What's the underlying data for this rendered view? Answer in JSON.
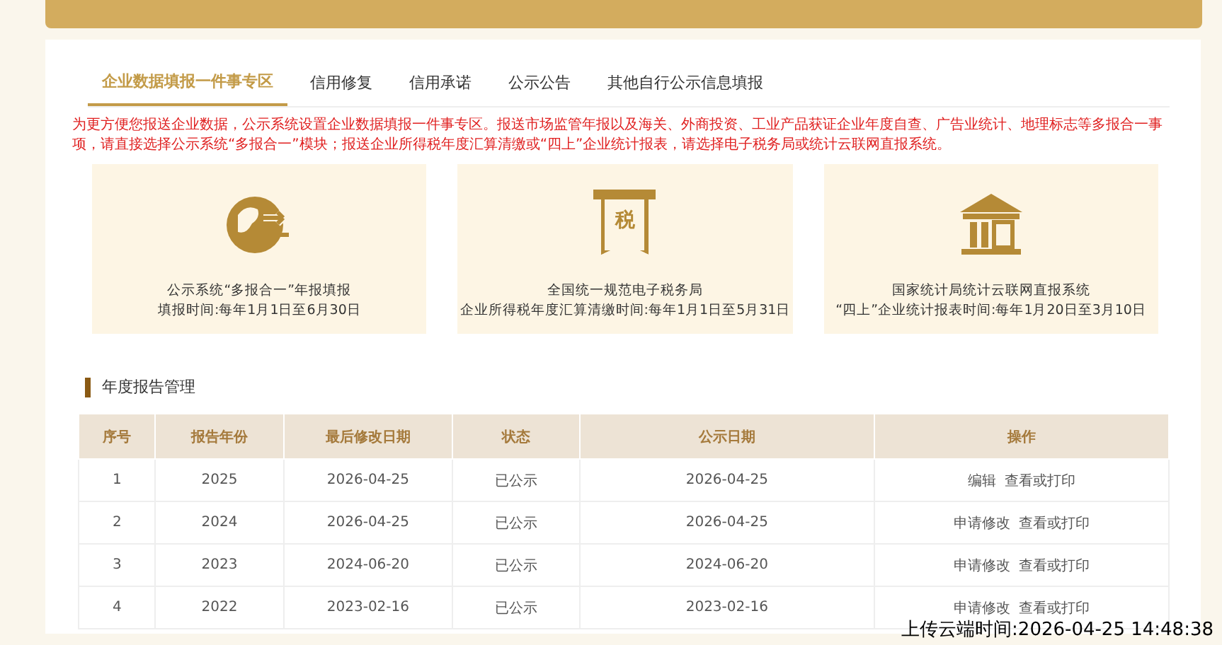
{
  "tabs": [
    {
      "label": "企业数据填报一件事专区",
      "selected": true
    },
    {
      "label": "信用修复",
      "selected": false
    },
    {
      "label": "信用承诺",
      "selected": false
    },
    {
      "label": "公示公告",
      "selected": false
    },
    {
      "label": "其他自行公示信息填报",
      "selected": false
    }
  ],
  "notice": "为更方便您报送企业数据，公示系统设置企业数据填报一件事专区。报送市场监管年报以及海关、外商投资、工业产品获证企业年度自查、广告业统计、地理标志等多报合一事项，请直接选择公示系统“多报合一”模块；报送企业所得税年度汇算清缴或“四上”企业统计报表，请选择电子税务局或统计云联网直报系统。",
  "services": [
    {
      "kind": "globe",
      "title": "公示系统“多报合一”年报填报",
      "period": "填报时间:每年1月1日至6月30日"
    },
    {
      "kind": "tax",
      "glyph": "税",
      "title": "全国统一规范电子税务局",
      "period": "企业所得税年度汇算清缴时间:每年1月1日至5月31日"
    },
    {
      "kind": "building",
      "title": "国家统计局统计云联网直报系统",
      "period": "“四上”企业统计报表时间:每年1月20日至3月10日"
    }
  ],
  "section_title": "年度报告管理",
  "table": {
    "columns": [
      "序号",
      "报告年份",
      "最后修改日期",
      "状态",
      "公示日期",
      "操作"
    ],
    "rows": [
      {
        "cells": [
          "1",
          "2025",
          "2026-04-25",
          "已公示",
          "2026-04-25"
        ],
        "actions": [
          "编辑",
          "查看或打印"
        ]
      },
      {
        "cells": [
          "2",
          "2024",
          "2026-04-25",
          "已公示",
          "2026-04-25"
        ],
        "actions": [
          "申请修改",
          "查看或打印"
        ]
      },
      {
        "cells": [
          "3",
          "2023",
          "2024-06-20",
          "已公示",
          "2024-06-20"
        ],
        "actions": [
          "申请修改",
          "查看或打印"
        ]
      },
      {
        "cells": [
          "4",
          "2022",
          "2023-02-16",
          "已公示",
          "2023-02-16"
        ],
        "actions": [
          "申请修改",
          "查看或打印"
        ]
      }
    ]
  },
  "upload_stamp": "上传云端时间:2026-04-25 14:48:38"
}
